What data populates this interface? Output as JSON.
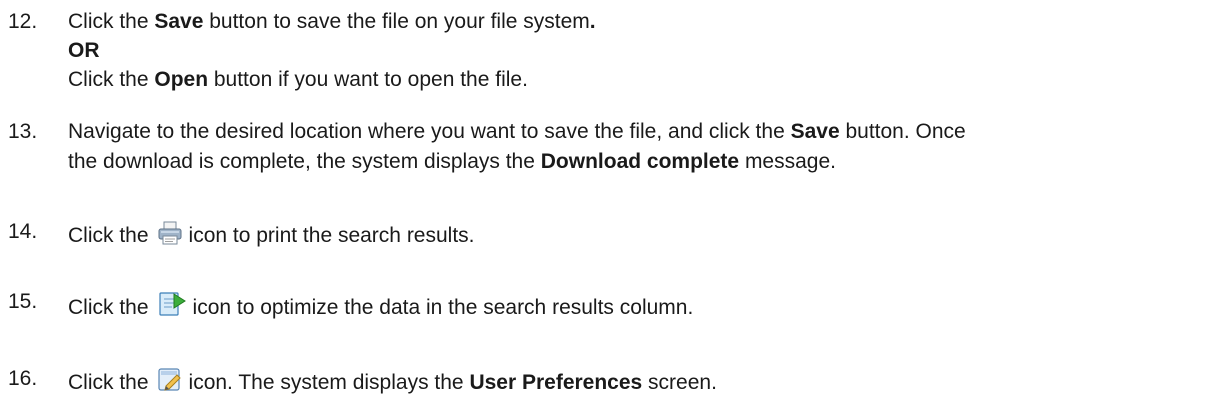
{
  "steps": [
    {
      "number": "12.",
      "lines": [
        {
          "a": "Click the ",
          "b": "Save",
          "c": " button to save the file on your file system",
          "d": "."
        },
        {
          "b": "OR"
        },
        {
          "a": "Click the ",
          "b": "Open",
          "c": " button if you want to open the file."
        }
      ]
    },
    {
      "number": "13.",
      "lines": [
        {
          "a": "Navigate to the desired location where you want to save the file, and click the ",
          "b": "Save",
          "c": " button. Once"
        },
        {
          "a": "the download is complete, the system displays the ",
          "b": "Download complete",
          "c": " message."
        }
      ]
    },
    {
      "number": "14.",
      "a": "Click the",
      "icon": "printer-icon",
      "c": "icon to print the search results."
    },
    {
      "number": "15.",
      "a": "Click the",
      "icon": "optimize-data-icon",
      "c": "icon to optimize the data in the search results column."
    },
    {
      "number": "16.",
      "a": "Click the",
      "icon": "user-preferences-edit-icon",
      "c": "icon. The system displays the ",
      "b": "User Preferences",
      "d": " screen."
    }
  ]
}
